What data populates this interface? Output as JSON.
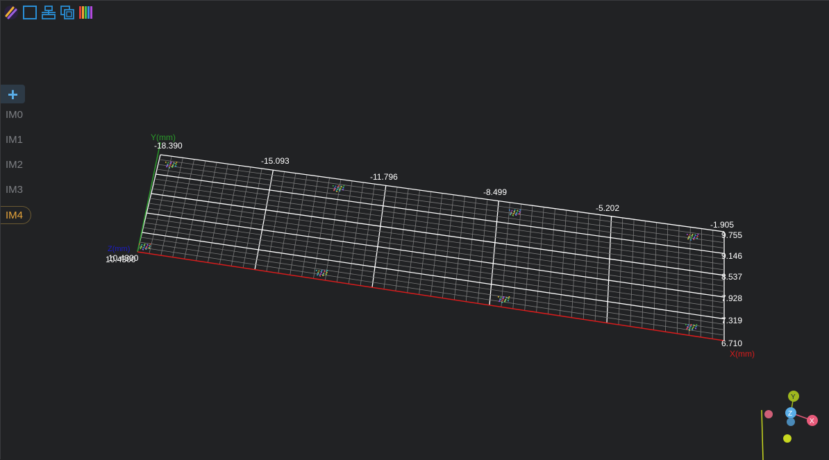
{
  "toolbar": {
    "buttons": [
      {
        "name": "logo-icon"
      },
      {
        "name": "square-select-icon"
      },
      {
        "name": "align-icon"
      },
      {
        "name": "copy-icon"
      },
      {
        "name": "colorbar-icon"
      }
    ]
  },
  "sidebar": {
    "add_label": "+",
    "items": [
      {
        "label": "IM0"
      },
      {
        "label": "IM1"
      },
      {
        "label": "IM2"
      },
      {
        "label": "IM3"
      },
      {
        "label": "IM4"
      }
    ],
    "active_index": 4
  },
  "plot": {
    "y_axis_title": "Y(mm)",
    "x_axis_title": "X(mm)",
    "top_ticks": [
      "-18.390",
      "-15.093",
      "-11.796",
      "-8.499",
      "-5.202",
      "-1.905"
    ],
    "right_ticks": [
      "9.755",
      "9.146",
      "8.537",
      "7.928",
      "7.319",
      "6.710"
    ],
    "z_label_overlap": "10.4300",
    "z_axis_stub": "Z(mm)"
  },
  "gizmo": {
    "y_label": "Y",
    "z_label": "Z",
    "x_label": "X"
  },
  "colors": {
    "accent_active": "#e5a33b",
    "toolbar_blue": "#2a8fd6",
    "x_axis": "#d81c1c",
    "y_axis": "#2a9a2a",
    "z_axis": "#1c1cc8",
    "grid": "#8a8a8a"
  }
}
